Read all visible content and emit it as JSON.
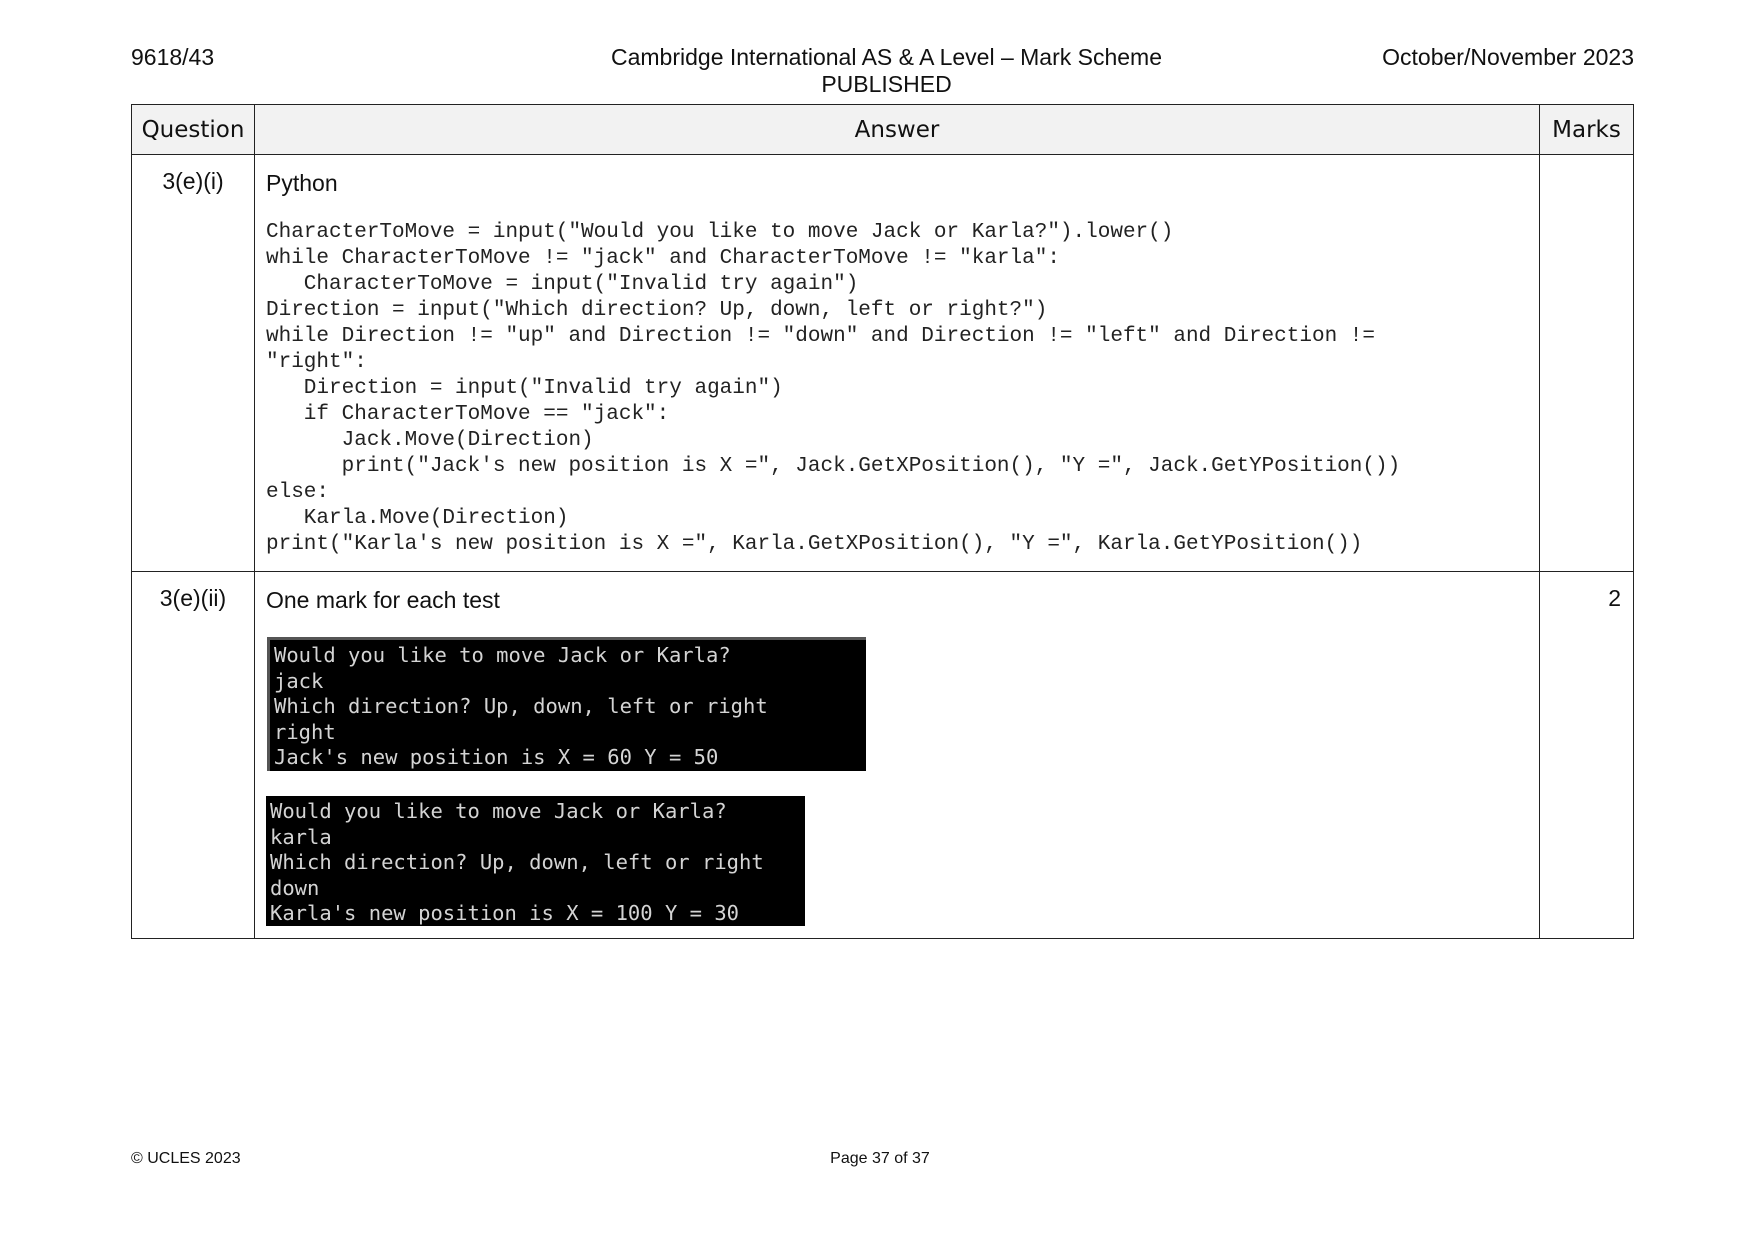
{
  "header": {
    "paper_code": "9618/43",
    "title": "Cambridge International AS & A Level – Mark Scheme",
    "subtitle": "PUBLISHED",
    "session": "October/November 2023"
  },
  "table": {
    "headers": {
      "question": "Question",
      "answer": "Answer",
      "marks": "Marks"
    },
    "rows": [
      {
        "question": "3(e)(i)",
        "answer_title": "Python",
        "code_lines": [
          "CharacterToMove = input(\"Would you like to move Jack or Karla?\").lower()",
          "while CharacterToMove != \"jack\" and CharacterToMove != \"karla\":",
          "   CharacterToMove = input(\"Invalid try again\")",
          "Direction = input(\"Which direction? Up, down, left or right?\")",
          "while Direction != \"up\" and Direction != \"down\" and Direction != \"left\" and Direction !=",
          "\"right\":",
          "   Direction = input(\"Invalid try again\")",
          "   if CharacterToMove == \"jack\":",
          "      Jack.Move(Direction)",
          "      print(\"Jack's new position is X =\", Jack.GetXPosition(), \"Y =\", Jack.GetYPosition())",
          "else:",
          "   Karla.Move(Direction)",
          "print(\"Karla's new position is X =\", Karla.GetXPosition(), \"Y =\", Karla.GetYPosition())"
        ],
        "marks": ""
      },
      {
        "question": "3(e)(ii)",
        "answer_title": "One mark for each test",
        "console1": [
          "Would you like to move Jack or Karla?",
          "jack",
          "Which direction? Up, down, left or right",
          "right",
          "Jack's new position is X = 60 Y = 50"
        ],
        "console2": [
          "Would you like to move Jack or Karla?",
          "karla",
          "Which direction? Up, down, left or right",
          "down",
          "Karla's new position is X = 100 Y = 30"
        ],
        "marks": "2"
      }
    ]
  },
  "footer": {
    "copyright": "© UCLES 2023",
    "page": "Page 37 of 37"
  }
}
